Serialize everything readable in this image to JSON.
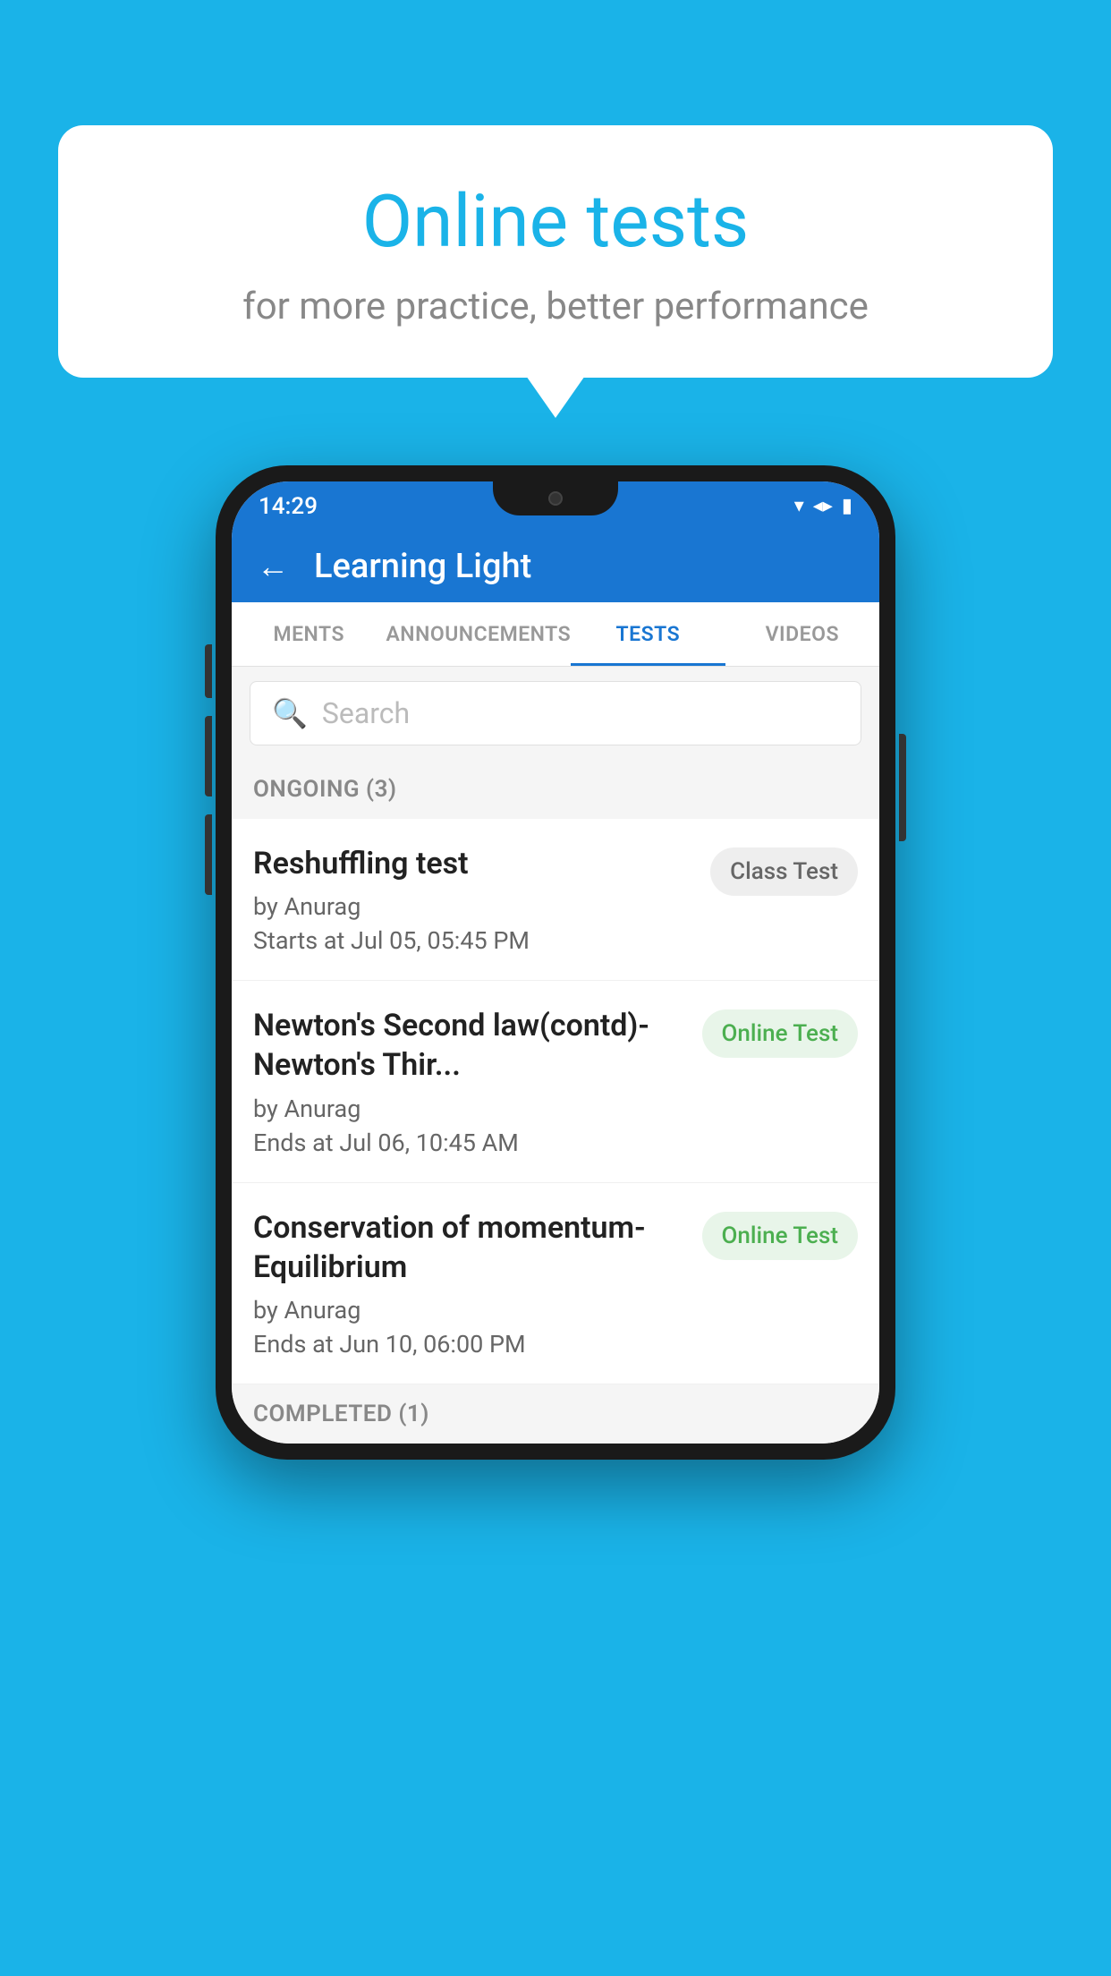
{
  "background_color": "#1ab3e8",
  "bubble": {
    "title": "Online tests",
    "subtitle": "for more practice, better performance"
  },
  "phone": {
    "status_bar": {
      "time": "14:29",
      "wifi": "▼",
      "signal": "▲",
      "battery": "▐"
    },
    "app_bar": {
      "back_label": "←",
      "title": "Learning Light"
    },
    "tabs": [
      {
        "label": "MENTS",
        "active": false
      },
      {
        "label": "ANNOUNCEMENTS",
        "active": false
      },
      {
        "label": "TESTS",
        "active": true
      },
      {
        "label": "VIDEOS",
        "active": false
      }
    ],
    "search": {
      "placeholder": "Search"
    },
    "section_ongoing": {
      "label": "ONGOING (3)"
    },
    "tests": [
      {
        "name": "Reshuffling test",
        "author": "by Anurag",
        "date": "Starts at  Jul 05, 05:45 PM",
        "badge": "Class Test",
        "badge_type": "class"
      },
      {
        "name": "Newton's Second law(contd)-Newton's Thir...",
        "author": "by Anurag",
        "date": "Ends at  Jul 06, 10:45 AM",
        "badge": "Online Test",
        "badge_type": "online"
      },
      {
        "name": "Conservation of momentum-Equilibrium",
        "author": "by Anurag",
        "date": "Ends at  Jun 10, 06:00 PM",
        "badge": "Online Test",
        "badge_type": "online"
      }
    ],
    "section_completed": {
      "label": "COMPLETED (1)"
    }
  }
}
